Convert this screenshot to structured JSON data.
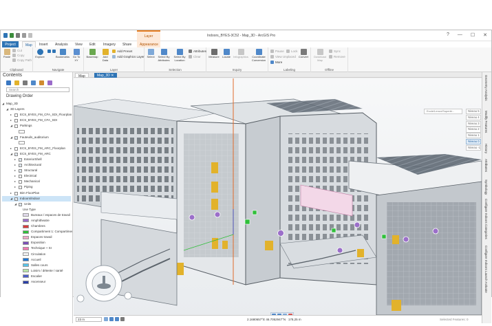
{
  "window": {
    "title": "Indoors_BYES-3C52 - Map_3D - ArcGIS Pro",
    "context_tab": "Layer",
    "buttons": [
      "?",
      "—",
      "☐",
      "✕"
    ]
  },
  "tabs": [
    "Project",
    "Map",
    "Insert",
    "Analysis",
    "View",
    "Edit",
    "Imagery",
    "Share",
    "Appearance"
  ],
  "active_tab": "Map",
  "command_search": {
    "placeholder": "Command Search (Alt+Q)"
  },
  "user": "Sophie (ArcGIS Indoors)",
  "ribbon": {
    "clipboard": {
      "label": "Clipboard",
      "paste": "Paste",
      "cut": "Cut",
      "copy": "Copy",
      "copy_path": "Copy Path"
    },
    "navigate": {
      "label": "Navigate",
      "explore": "Explore",
      "bookmarks": "Bookmarks",
      "go_to_xy": "Go To XY"
    },
    "layer": {
      "label": "Layer",
      "basemap": "Basemap",
      "add_data": "Add Data",
      "add_preset": "Add Preset",
      "add_graphics_layer": "Add Graphics Layer"
    },
    "selection": {
      "label": "Selection",
      "select": "Select",
      "by_attributes": "Select By Attributes",
      "by_location": "Select By Location",
      "attributes": "Attributes",
      "clear": "Clear"
    },
    "inquiry": {
      "label": "Inquiry",
      "measure": "Measure",
      "locate": "Locate",
      "infographics": "Infographics",
      "coordinate_conversion": "Coordinate Conversion"
    },
    "labeling": {
      "label": "Labeling",
      "pause": "Pause",
      "lock": "Lock",
      "view_unplaced": "View Unplaced",
      "more": "More",
      "convert": "Convert"
    },
    "offline": {
      "label": "Offline",
      "download_map": "Download Map",
      "sync": "Sync",
      "remove": "Remove"
    }
  },
  "view_tabs": [
    {
      "label": "Map"
    },
    {
      "label": "Map_3D"
    }
  ],
  "contents": {
    "title": "Contents",
    "search_placeholder": "Search",
    "drawing_order": "Drawing Order",
    "rows": [
      {
        "label": "Map_3D",
        "indent": 0,
        "exp": "◢",
        "cb": null
      },
      {
        "label": "3D Layers",
        "indent": 1,
        "exp": "◢",
        "cb": null
      },
      {
        "label": "ECS_BYES_FM_CFA_SDI_Floorplan",
        "indent": 2,
        "exp": "▸",
        "cb": ""
      },
      {
        "label": "ECS_BYES_FM_CFA_SDI",
        "indent": 2,
        "exp": "▸",
        "cb": ""
      },
      {
        "label": "Parkings",
        "indent": 2,
        "exp": "◢",
        "cb": ""
      },
      {
        "label": "",
        "indent": 3,
        "exp": "",
        "cb": null,
        "swatch": "#ffffff"
      },
      {
        "label": "Fauteuils_auditorium",
        "indent": 2,
        "exp": "◢",
        "cb": "✓"
      },
      {
        "label": "",
        "indent": 3,
        "exp": "",
        "cb": null,
        "swatch": "#ffffff"
      },
      {
        "label": "ECS_BYES_FM_ARC_Floorplan",
        "indent": 2,
        "exp": "▸",
        "cb": ""
      },
      {
        "label": "ECS_BYES_FM_ARC",
        "indent": 2,
        "exp": "◢",
        "cb": "✓"
      },
      {
        "label": "ExteriorShell",
        "indent": 3,
        "exp": "▸",
        "cb": "✓"
      },
      {
        "label": "Architectural",
        "indent": 3,
        "exp": "▸",
        "cb": "✓"
      },
      {
        "label": "Structural",
        "indent": 3,
        "exp": "▸",
        "cb": "✓"
      },
      {
        "label": "Electrical",
        "indent": 3,
        "exp": "▸",
        "cb": ""
      },
      {
        "label": "Mechanical",
        "indent": 3,
        "exp": "▸",
        "cb": ""
      },
      {
        "label": "Piping",
        "indent": 3,
        "exp": "▸",
        "cb": ""
      },
      {
        "label": "Bim FloorPlan",
        "indent": 2,
        "exp": "▸",
        "cb": ""
      },
      {
        "label": "Indoors/Indoor",
        "indent": 2,
        "exp": "◢",
        "cb": "✓",
        "selected": true
      },
      {
        "label": "Units",
        "indent": 3,
        "exp": "◢",
        "cb": "✓"
      },
      {
        "label": "Use Type",
        "indent": 4,
        "exp": "",
        "cb": null
      },
      {
        "label": "Bureaux / espaces de travail",
        "indent": 4,
        "exp": "",
        "cb": null,
        "swatch": "#e3dcec"
      },
      {
        "label": "Amphitheatre",
        "indent": 4,
        "exp": "",
        "cb": null,
        "swatch": "#9b6fc9"
      },
      {
        "label": "Chambres",
        "indent": 4,
        "exp": "",
        "cb": null,
        "swatch": "#d83c3c"
      },
      {
        "label": "Compartiment 1: Compartiment",
        "indent": 4,
        "exp": "",
        "cb": null,
        "swatch": "#2fbf3a"
      },
      {
        "label": "Espaces travail",
        "indent": 4,
        "exp": "",
        "cb": null,
        "swatch": "#f0a6c8"
      },
      {
        "label": "Exposition",
        "indent": 4,
        "exp": "",
        "cb": null,
        "swatch": "#7b4fb8"
      },
      {
        "label": "Technique + SI",
        "indent": 4,
        "exp": "",
        "cb": null,
        "swatch": "#f07ab0"
      },
      {
        "label": "Circulation",
        "indent": 4,
        "exp": "",
        "cb": null,
        "swatch": "#f2f2f2"
      },
      {
        "label": "Accueil",
        "indent": 4,
        "exp": "",
        "cb": null,
        "swatch": "#1e78d7"
      },
      {
        "label": "Salles cours",
        "indent": 4,
        "exp": "",
        "cb": null,
        "swatch": "#59c3e8"
      },
      {
        "label": "Loisirs / détente / santé",
        "indent": 4,
        "exp": "",
        "cb": null,
        "swatch": "#b7e3a5"
      },
      {
        "label": "Escalier",
        "indent": 4,
        "exp": "",
        "cb": null,
        "swatch": "#4d5ec8"
      },
      {
        "label": "Ascenseur",
        "indent": 4,
        "exp": "",
        "cb": null,
        "swatch": "#2a3fa8"
      }
    ]
  },
  "floor_filter": {
    "search_placeholder": "Ecole/Lenzo/Superbi...",
    "levels": [
      "Niveau 5",
      "Niveau 4",
      "Niveau 3",
      "Niveau 2",
      "Niveau 1",
      "Niveau 0",
      "Niveau -1"
    ],
    "selected_level": "Niveau 0"
  },
  "right_dock": [
    "Geometry Analysis",
    "Modify Features",
    "History",
    "Attributes",
    "Symbology",
    "Configure Indoors Categories",
    "Configure Indoors Launch Activate"
  ],
  "status": {
    "scale": "23 m",
    "coords": "2.1680657°E 46.7052947°N",
    "elev": "178,25 m",
    "selected": "Selected Features: 0"
  },
  "colors": {
    "accent": "#2e74b5",
    "context": "#e67e22",
    "amphi": "#9b6fc9",
    "green": "#2fbf3a",
    "pink": "#f07ab0",
    "stairs": "#e2b22b"
  }
}
